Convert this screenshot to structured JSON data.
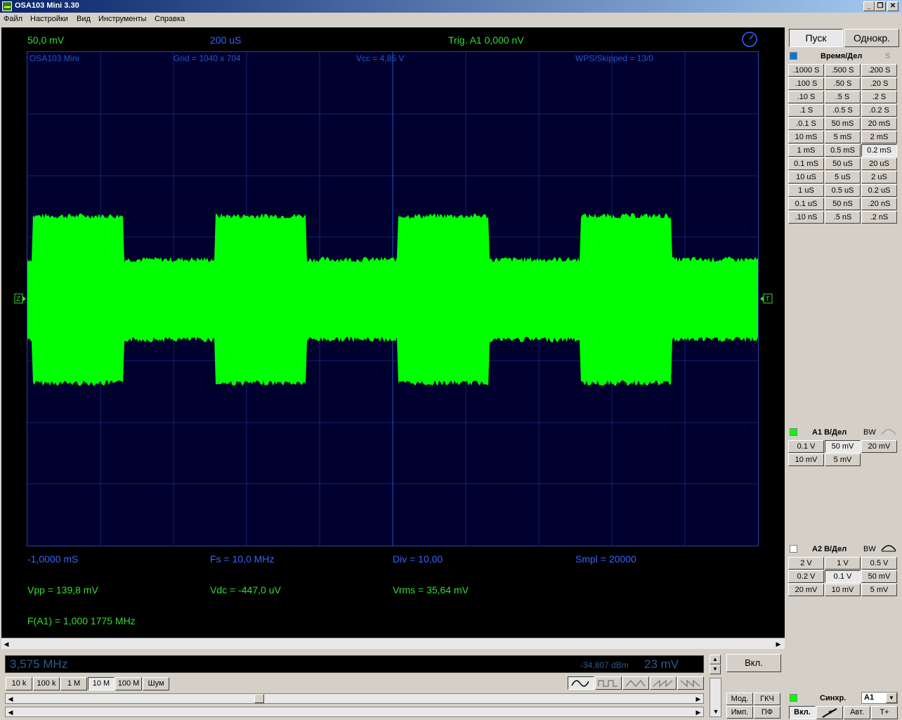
{
  "window": {
    "title": "OSA103 Mini 3.30",
    "controls": [
      "_",
      "❐",
      "✕"
    ]
  },
  "menu": [
    "Файл",
    "Настройки",
    "Вид",
    "Инструменты",
    "Справка"
  ],
  "scope": {
    "top_volts": "50,0 mV",
    "top_time": "200 uS",
    "trigger": "Trig. A1  0,000 nV",
    "grid_labels": {
      "device": "OSA103 Mini",
      "grid": "Grid = 1040 x 704",
      "vcc": "Vcc = 4,85 V",
      "wps": "WPS/Skipped  = 13/0"
    },
    "marker_left": "Z",
    "marker_right": "T",
    "bottom_row1": [
      "-1,0000 mS",
      "Fs = 10,0 MHz",
      "Div = 10,00",
      "Smpl = 20000"
    ],
    "bottom_row2": [
      "Vpp = 139,8 mV",
      "Vdc = -447,0 uV",
      "Vrms = 35,64 mV"
    ],
    "bottom_row3": "F(A1) = 1,000 1775 MHz",
    "colors": {
      "trace": "#00ff00",
      "grid_bg": "#00002e",
      "grid_line": "#2244aa"
    }
  },
  "generator": {
    "freq": "3,575 MHz",
    "dbm": "-34,807 dBm",
    "amp": "23 mV",
    "range_buttons": [
      "10 k",
      "100 k",
      "1 M",
      "10 M",
      "100 M",
      "Шум"
    ],
    "range_selected": "10 M",
    "waveforms": [
      "sine-wave-icon",
      "square-wave-icon",
      "triangle-wave-icon",
      "sawtooth-wave-icon",
      "reverse-sawtooth-wave-icon"
    ],
    "on_button": "Вкл.",
    "mod_buttons": [
      "Мод.",
      "ГКЧ",
      "Имп.",
      "ПФ"
    ]
  },
  "right_panel": {
    "start_button": "Пуск",
    "single_button": "Однокр.",
    "time_label": "Время/Дел",
    "time_unit": "S",
    "time_buttons": [
      ".1000 S",
      ".500 S",
      ".200 S",
      ".100 S",
      ".50 S",
      ".20 S",
      ".10 S",
      ".5 S",
      ".2 S",
      ".1 S",
      ".0.5 S",
      ".0.2 S",
      ".0.1 S",
      "50 mS",
      "20 mS",
      "10 mS",
      "5 mS",
      "2 mS",
      "1 mS",
      "0.5 mS",
      "0.2 mS",
      "0.1 mS",
      "50 uS",
      "20 uS",
      "10 uS",
      "5 uS",
      "2 uS",
      "1 uS",
      "0.5 uS",
      "0.2 uS",
      "0.1 uS",
      "50 nS",
      ".20 nS",
      ".10 nS",
      ".5 nS",
      ".2 nS"
    ],
    "time_selected": "0.2 mS",
    "a1_label": "A1 В/Дел",
    "a1_bw": "BW",
    "a1_buttons": [
      "0.1 V",
      "50 mV",
      "20 mV",
      "10 mV",
      "5 mV"
    ],
    "a1_selected": "50 mV",
    "a2_label": "A2 В/Дел",
    "a2_bw": "BW",
    "a2_buttons": [
      "2 V",
      "1 V",
      "0.5 V",
      "0.2 V",
      "0.1 V",
      "50 mV",
      "20 mV",
      "10 mV",
      "5 mV"
    ],
    "a2_selected": "0.1 V",
    "sync_label": "Синхр.",
    "sync_source": "A1",
    "sync_buttons": [
      "Вкл.",
      "Авт.",
      "T+"
    ]
  }
}
